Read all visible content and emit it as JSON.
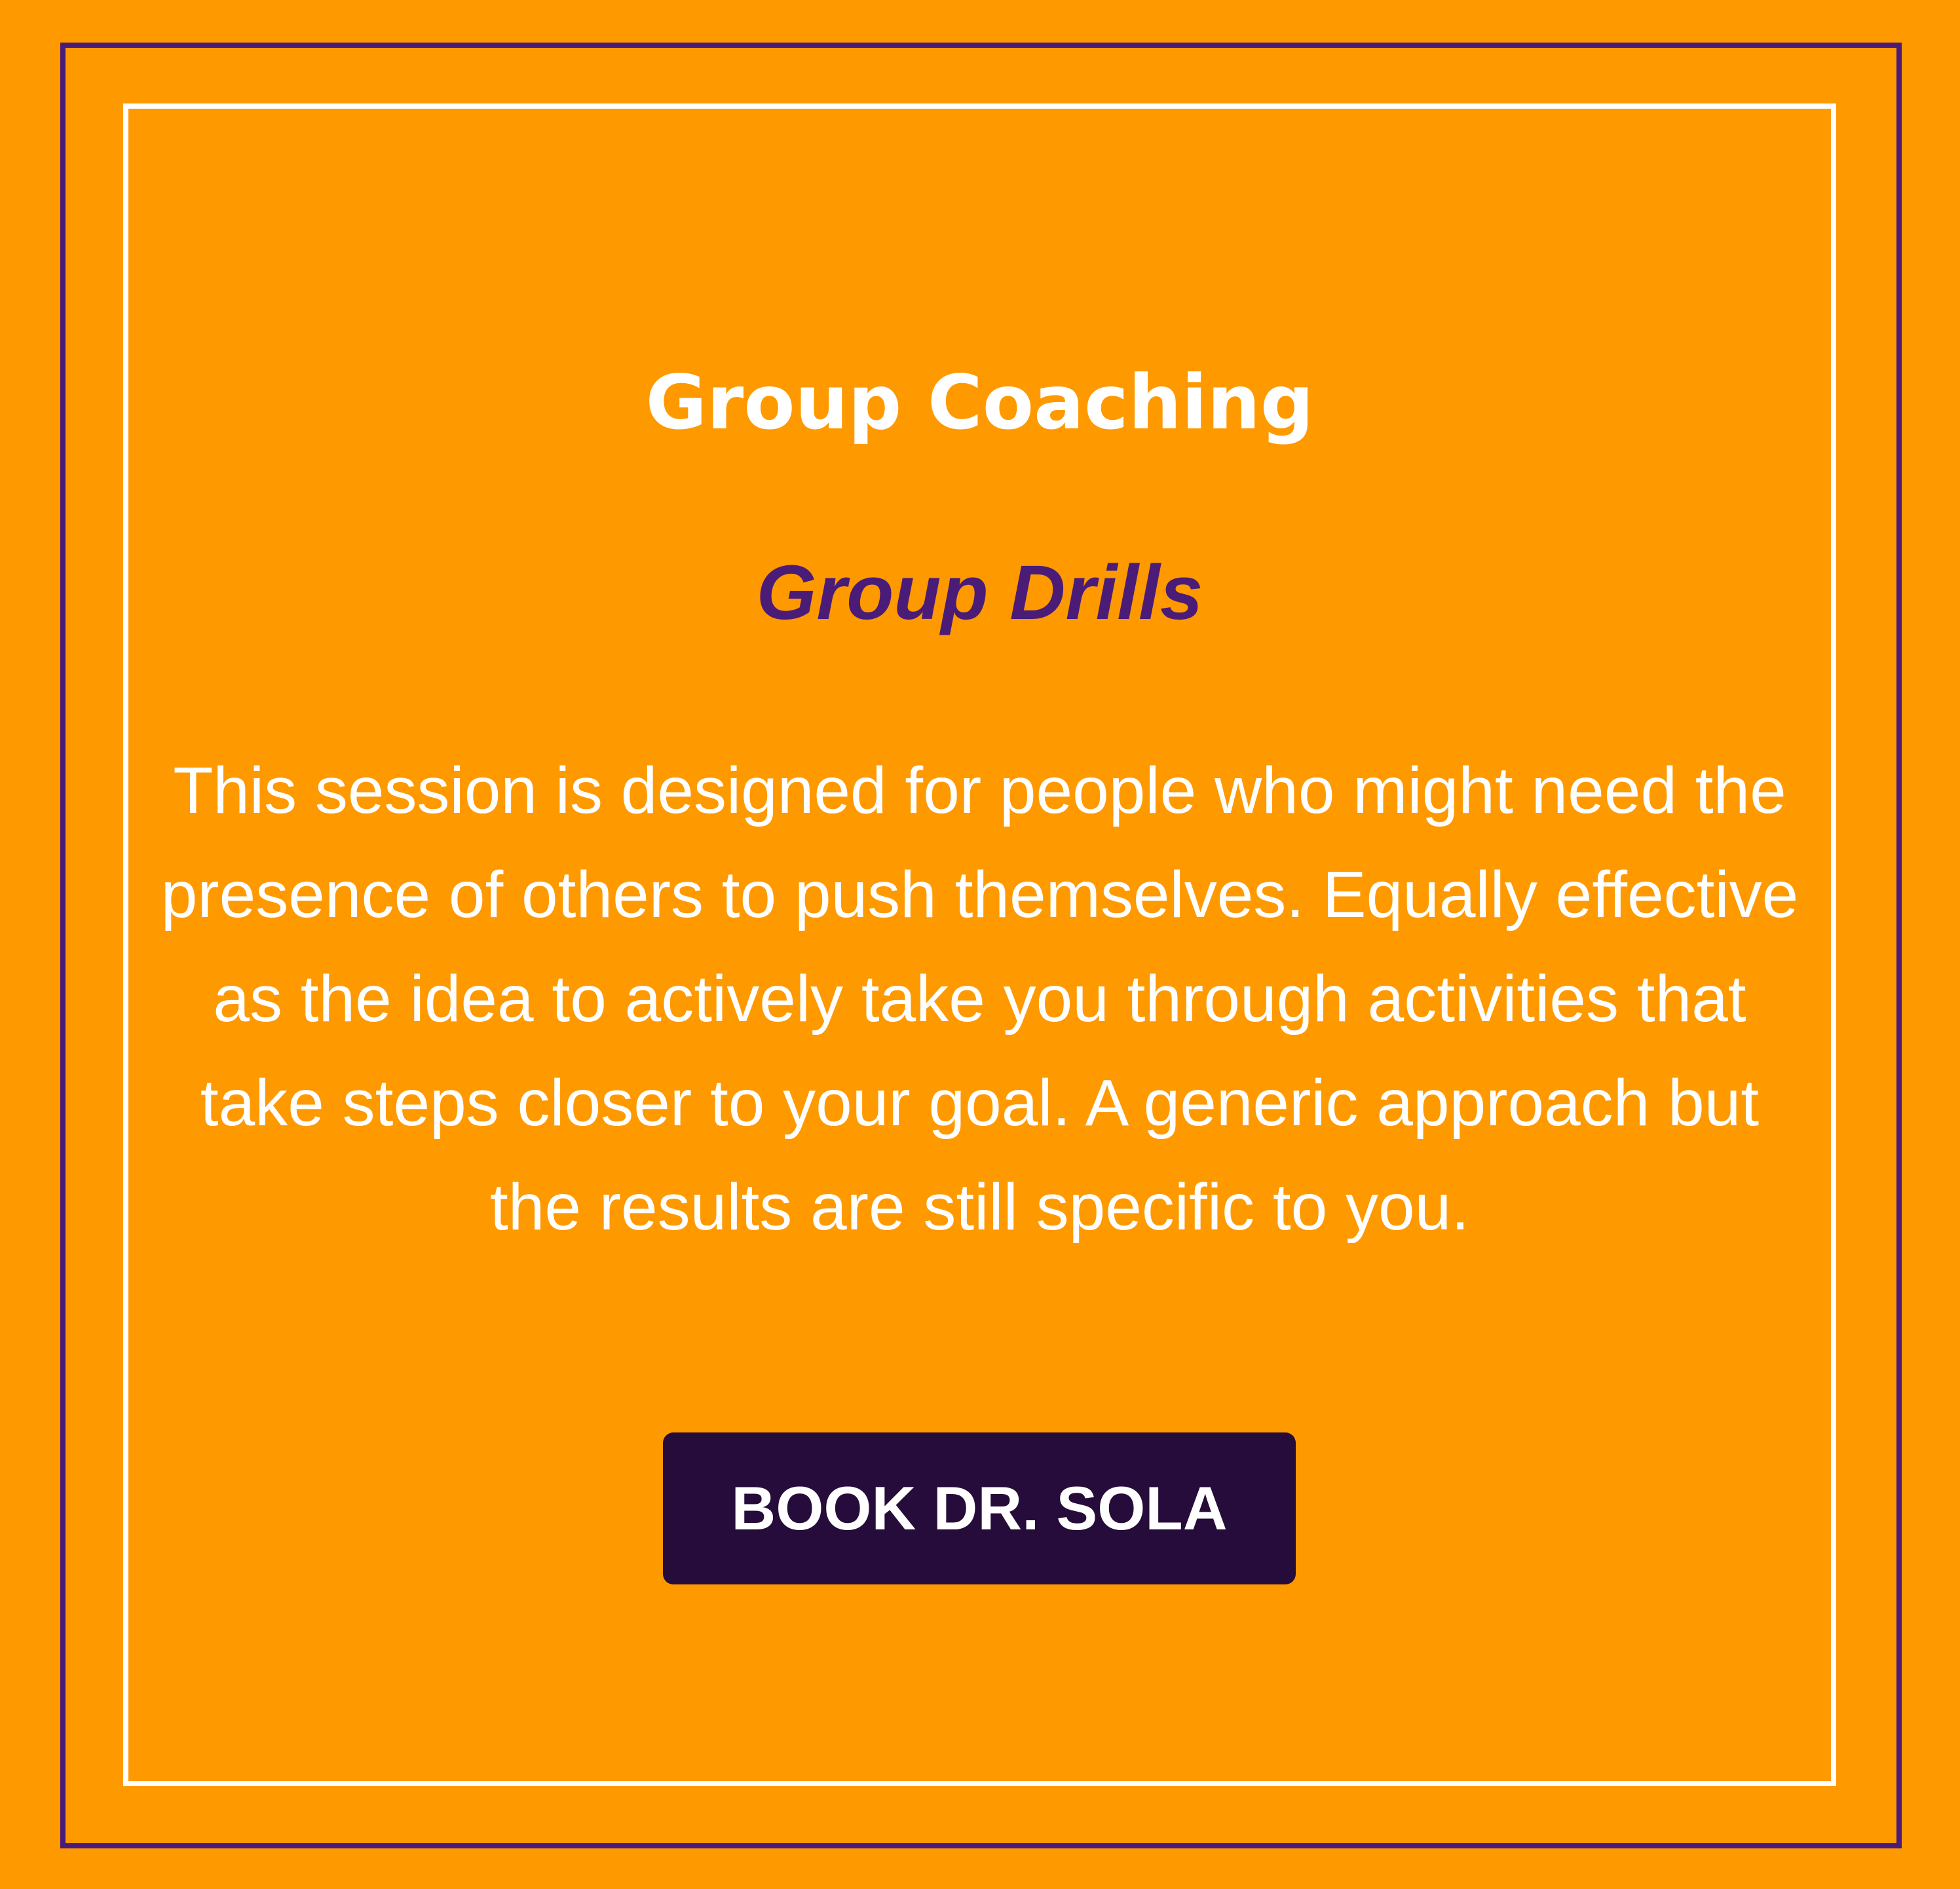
{
  "colors": {
    "background": "#FF9900",
    "outer_border": "#4A1C78",
    "inner_border": "#FFFFFF",
    "title_text": "#FFFFFF",
    "subtitle_text": "#4A1C78",
    "body_text": "#FFFFFF",
    "button_bg": "#260C3A",
    "button_text": "#FFFFFF"
  },
  "card": {
    "title": "Group Coaching",
    "subtitle": "Group Drills",
    "description": "This session is designed for people who might need the presence of others to push themselves. Equally effective as the idea to actively take you through activities that take steps closer to your goal. A generic approach but the results are still specific to you.",
    "button_label": "BOOK DR. SOLA"
  }
}
